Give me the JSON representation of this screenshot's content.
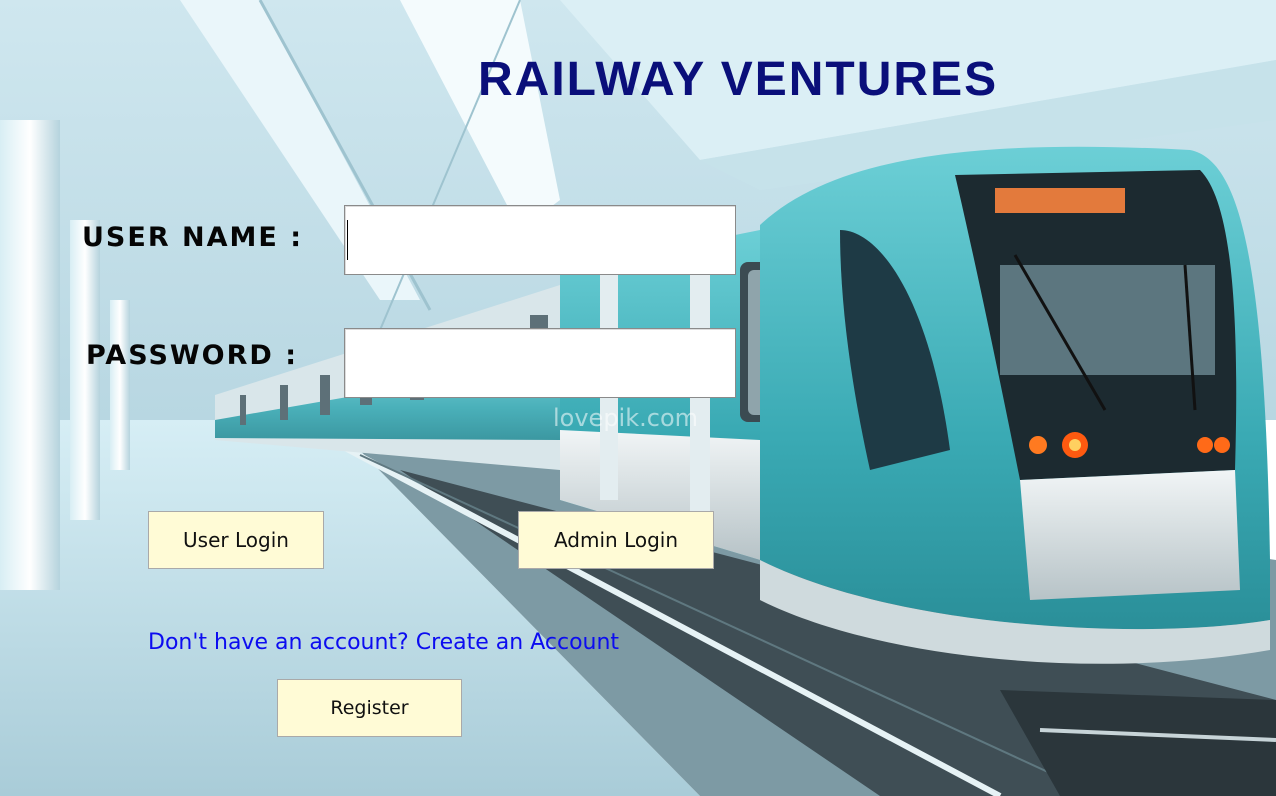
{
  "window": {
    "title": "RAILWAY VENTURES"
  },
  "login_form": {
    "username_label": "USER NAME :",
    "username_value": "",
    "password_label": "PASSWORD :",
    "password_value": "",
    "user_login_label": "User Login",
    "admin_login_label": "Admin Login"
  },
  "register_section": {
    "prompt_text": "Don't have an account? Create an Account",
    "register_label": "Register"
  },
  "background": {
    "watermark_text": "lovepik.com"
  },
  "colors": {
    "title": "#0a0f7a",
    "label": "#050505",
    "button_background": "#fffbd6",
    "link": "#0c0cf0",
    "train_body": "#3fb5bf"
  }
}
